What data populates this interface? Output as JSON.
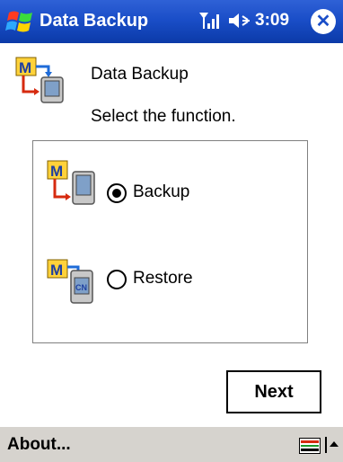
{
  "titlebar": {
    "title": "Data Backup",
    "clock": "3:09",
    "close_glyph": "✕",
    "icons": [
      "windows-start-icon",
      "signal-icon",
      "volume-icon",
      "close-icon"
    ]
  },
  "header": {
    "title": "Data Backup",
    "prompt": "Select the function."
  },
  "options": [
    {
      "label": "Backup",
      "selected": true,
      "icon": "backup-icon"
    },
    {
      "label": "Restore",
      "selected": false,
      "icon": "restore-icon"
    }
  ],
  "buttons": {
    "next": "Next"
  },
  "menubar": {
    "about": "About...",
    "icons": [
      "keyboard-icon",
      "sip-arrow-icon"
    ]
  },
  "colors": {
    "titlebar_blue": "#1a4ec8",
    "menubar_gray": "#d6d3ce",
    "icon_yellow": "#ffd23a",
    "icon_red": "#d62a0f",
    "icon_blue": "#1e6bd8"
  }
}
